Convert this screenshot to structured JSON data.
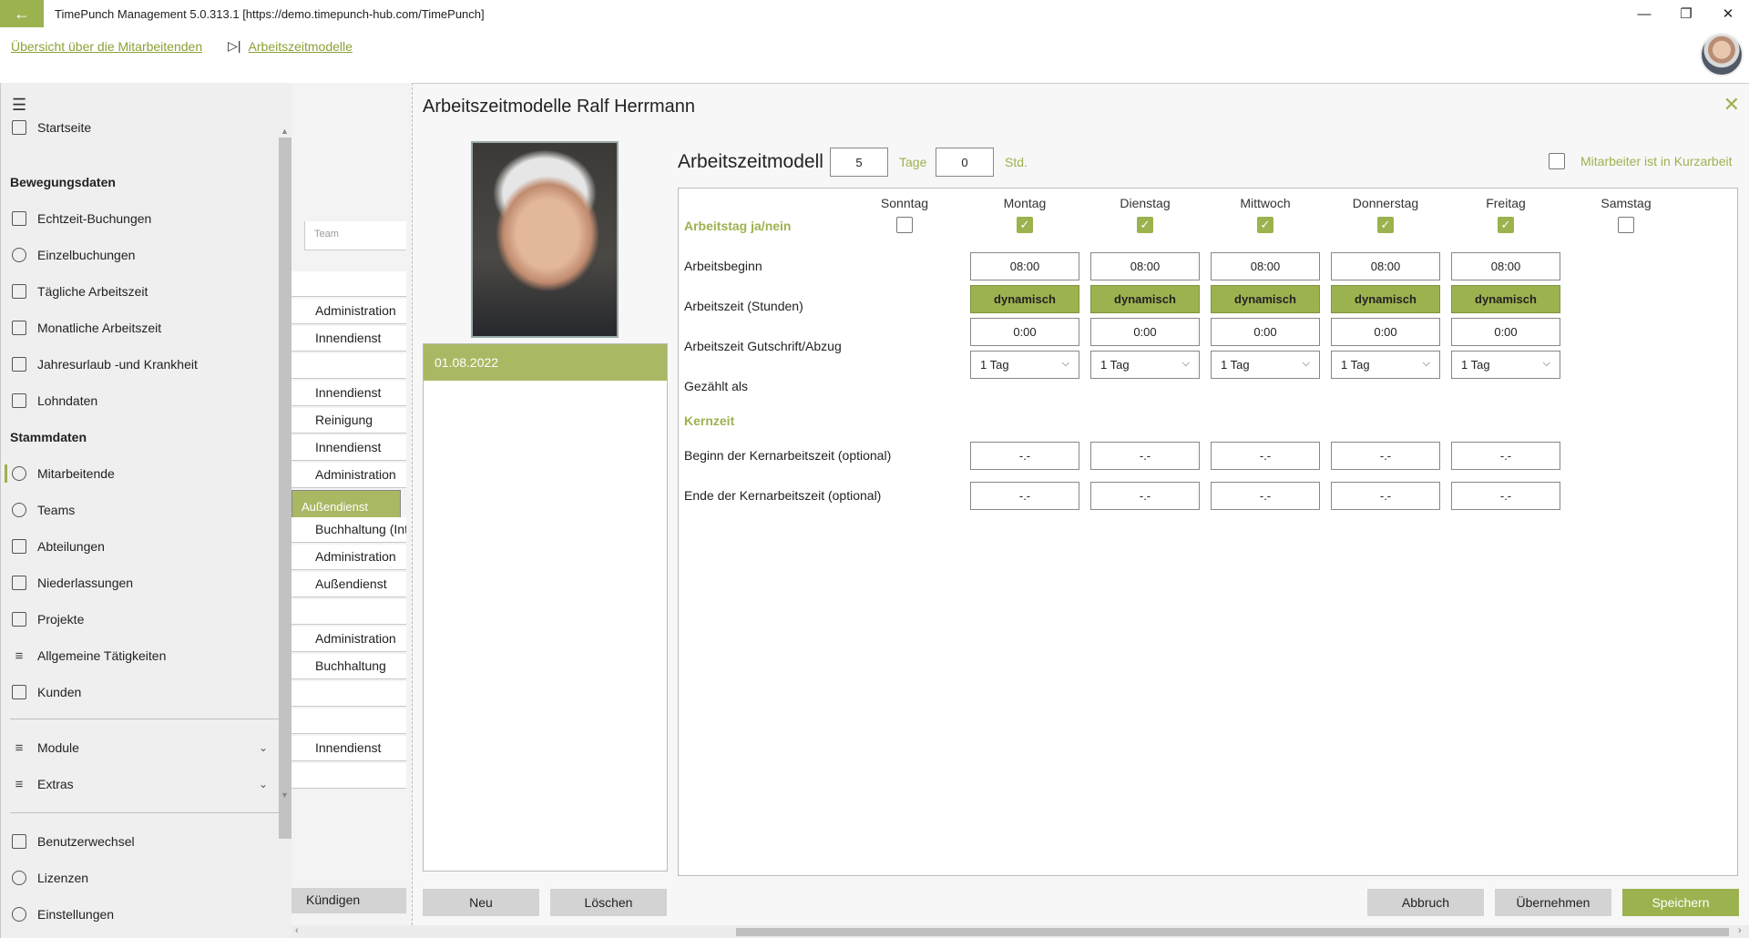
{
  "window": {
    "title": "TimePunch Management 5.0.313.1 [https://demo.timepunch-hub.com/TimePunch]",
    "minimize": "—",
    "restore": "❐",
    "close": "✕",
    "back": "←"
  },
  "breadcrumb": {
    "overview": "Übersicht über die Mitarbeitenden",
    "separator": "▷|",
    "current": "Arbeitszeitmodelle"
  },
  "sidebar": {
    "menu_icon": "☰",
    "items": [
      {
        "label": "Startseite",
        "icon": "monitor-icon"
      },
      {
        "label": "Echtzeit-Buchungen",
        "icon": "clock-icon"
      },
      {
        "label": "Einzelbuchungen",
        "icon": "clock-icon"
      },
      {
        "label": "Tägliche Arbeitszeit",
        "icon": "calendar-icon"
      },
      {
        "label": "Monatliche Arbeitszeit",
        "icon": "calendar-icon"
      },
      {
        "label": "Jahresurlaub -und Krankheit",
        "icon": "calendar-icon"
      },
      {
        "label": "Lohndaten",
        "icon": "calculator-icon"
      },
      {
        "label": "Mitarbeitende",
        "icon": "person-icon"
      },
      {
        "label": "Teams",
        "icon": "people-icon"
      },
      {
        "label": "Abteilungen",
        "icon": "building-icon"
      },
      {
        "label": "Niederlassungen",
        "icon": "office-icon"
      },
      {
        "label": "Projekte",
        "icon": "project-icon"
      },
      {
        "label": "Allgemeine Tätigkeiten",
        "icon": "list-icon"
      },
      {
        "label": "Kunden",
        "icon": "customer-icon"
      },
      {
        "label": "Module",
        "icon": "list-icon"
      },
      {
        "label": "Extras",
        "icon": "list-icon"
      },
      {
        "label": "Benutzerwechsel",
        "icon": "switch-user-icon"
      },
      {
        "label": "Lizenzen",
        "icon": "license-icon"
      },
      {
        "label": "Einstellungen",
        "icon": "gear-icon"
      }
    ],
    "section_movement": "Bewegungsdaten",
    "section_master": "Stammdaten",
    "chevron": "⌄"
  },
  "team_column": {
    "header_placeholder": "Team",
    "rows": [
      "",
      "Administration",
      "Innendienst",
      "",
      "Innendienst",
      "Reinigung",
      "Innendienst",
      "Administration",
      "Außendienst",
      "Buchhaltung (Int",
      "Administration",
      "Außendienst",
      "",
      "Administration",
      "Buchhaltung",
      "",
      "",
      "Innendienst",
      ""
    ],
    "selected_index": 8,
    "terminate_button": "Kündigen"
  },
  "dialog": {
    "title": "Arbeitszeitmodelle Ralf Herrmann",
    "close": "✕",
    "dates": [
      "01.08.2022"
    ],
    "new_button": "Neu",
    "delete_button": "Löschen",
    "cancel_button": "Abbruch",
    "apply_button": "Übernehmen",
    "save_button": "Speichern"
  },
  "model": {
    "label": "Arbeitszeitmodell",
    "days_value": "5",
    "days_unit": "Tage",
    "hours_value": "0",
    "hours_unit": "Std.",
    "short_time_label": "Mitarbeiter ist in Kurzarbeit",
    "short_time_checked": false,
    "days": [
      "Sonntag",
      "Montag",
      "Dienstag",
      "Mittwoch",
      "Donnerstag",
      "Freitag",
      "Samstag"
    ],
    "workday_label": "Arbeitstag ja/nein",
    "workday_checked": [
      false,
      true,
      true,
      true,
      true,
      true,
      false
    ],
    "start_label": "Arbeitsbeginn",
    "start_values": [
      "08:00",
      "08:00",
      "08:00",
      "08:00",
      "08:00"
    ],
    "hours_label": "Arbeitszeit (Stunden)",
    "hours_values": [
      "dynamisch",
      "dynamisch",
      "dynamisch",
      "dynamisch",
      "dynamisch"
    ],
    "credit_label": "Arbeitszeit Gutschrift/Abzug",
    "credit_values": [
      "0:00",
      "0:00",
      "0:00",
      "0:00",
      "0:00"
    ],
    "counted_label": "Gezählt als",
    "counted_values": [
      "1 Tag",
      "1 Tag",
      "1 Tag",
      "1 Tag",
      "1 Tag"
    ],
    "core_section": "Kernzeit",
    "core_begin_label": "Beginn der Kernarbeitszeit (optional)",
    "core_begin_values": [
      "-.-",
      "-.-",
      "-.-",
      "-.-",
      "-.-"
    ],
    "core_end_label": "Ende der Kernarbeitszeit (optional)",
    "core_end_values": [
      "-.-",
      "-.-",
      "-.-",
      "-.-",
      "-.-"
    ]
  },
  "colors": {
    "accent": "#9cb24f",
    "selected_row": "#a9b863"
  }
}
